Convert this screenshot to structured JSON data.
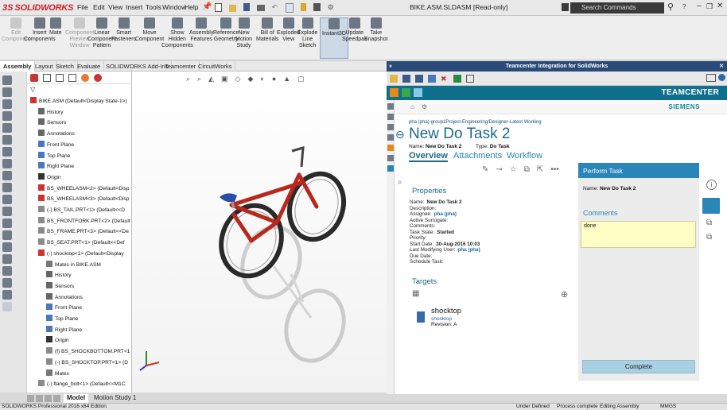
{
  "app": {
    "brand_ds": "3S",
    "brand_name": "SOLIDWORKS",
    "document_title": "BIKE.ASM.SLDASM [Read-only]",
    "search_placeholder": "Search Commands"
  },
  "menu": [
    "File",
    "Edit",
    "View",
    "Insert",
    "Tools",
    "Window",
    "Help"
  ],
  "commands": [
    {
      "label": "Edit\nComponent",
      "disabled": true,
      "icon": "edit-component-icon"
    },
    {
      "label": "Insert\nComponents",
      "disabled": false,
      "icon": "insert-components-icon"
    },
    {
      "label": "Mate",
      "disabled": false,
      "icon": "mate-icon"
    },
    {
      "label": "Component\nPreview\nWindow",
      "disabled": true,
      "icon": "component-preview-icon"
    },
    {
      "label": "Linear\nComponent\nPattern",
      "disabled": false,
      "icon": "linear-pattern-icon"
    },
    {
      "label": "Smart\nFasteners",
      "disabled": false,
      "icon": "smart-fasteners-icon"
    },
    {
      "label": "Move\nComponent",
      "disabled": false,
      "icon": "move-component-icon"
    },
    {
      "label": "Show\nHidden\nComponents",
      "disabled": false,
      "icon": "show-hidden-icon"
    },
    {
      "label": "Assembly\nFeatures",
      "disabled": false,
      "icon": "assembly-features-icon"
    },
    {
      "label": "Reference\nGeometry",
      "disabled": false,
      "icon": "reference-geometry-icon"
    },
    {
      "label": "New\nMotion\nStudy",
      "disabled": false,
      "icon": "motion-study-icon"
    },
    {
      "label": "Bill of\nMaterials",
      "disabled": false,
      "icon": "bill-of-materials-icon"
    },
    {
      "label": "Exploded\nView",
      "disabled": false,
      "icon": "exploded-view-icon"
    },
    {
      "label": "Explode\nLine\nSketch",
      "disabled": false,
      "icon": "explode-line-icon"
    },
    {
      "label": "Instant3D",
      "disabled": false,
      "icon": "instant3d-icon",
      "active": true
    },
    {
      "label": "Update\nSpeedpak",
      "disabled": false,
      "icon": "speedpak-icon"
    },
    {
      "label": "Take\nSnapshot",
      "disabled": false,
      "icon": "snapshot-icon"
    }
  ],
  "tabs": [
    "Assembly",
    "Layout",
    "Sketch",
    "Evaluate",
    "SOLIDWORKS Add-Ins",
    "Teamcenter",
    "CircuitWorks"
  ],
  "tree": [
    {
      "label": "BIKE.ASM  (Default<Display State-1>)",
      "indent": 0,
      "icon": "assembly-icon"
    },
    {
      "label": "History",
      "indent": 1,
      "icon": "history-icon"
    },
    {
      "label": "Sensors",
      "indent": 1,
      "icon": "sensors-icon"
    },
    {
      "label": "Annotations",
      "indent": 1,
      "icon": "annotations-icon"
    },
    {
      "label": "Front Plane",
      "indent": 1,
      "icon": "plane-icon"
    },
    {
      "label": "Top Plane",
      "indent": 1,
      "icon": "plane-icon"
    },
    {
      "label": "Right Plane",
      "indent": 1,
      "icon": "plane-icon"
    },
    {
      "label": "Origin",
      "indent": 1,
      "icon": "origin-icon"
    },
    {
      "label": "BS_WHEELASM<2> (Default<Disp",
      "indent": 1,
      "icon": "subassembly-icon"
    },
    {
      "label": "BS_WHEELASM<3> (Default<Disp",
      "indent": 1,
      "icon": "subassembly-icon"
    },
    {
      "label": "(-) BS_TAIL.PRT<1> (Default<<D",
      "indent": 1,
      "icon": "part-icon"
    },
    {
      "label": "BS_FRONTFORK.PRT<2> (Default",
      "indent": 1,
      "icon": "part-icon"
    },
    {
      "label": "BS_FRAME.PRT<3> (Default<<De",
      "indent": 1,
      "icon": "part-icon"
    },
    {
      "label": "BS_SEAT.PRT<1> (Default<<Def",
      "indent": 1,
      "icon": "part-icon"
    },
    {
      "label": "(-) shocktop<1> (Default<Display",
      "indent": 1,
      "icon": "subassembly-icon"
    },
    {
      "label": "Mates in BIKE.ASM",
      "indent": 2,
      "icon": "mates-icon"
    },
    {
      "label": "History",
      "indent": 2,
      "icon": "history-icon"
    },
    {
      "label": "Sensors",
      "indent": 2,
      "icon": "sensors-icon"
    },
    {
      "label": "Annotations",
      "indent": 2,
      "icon": "annotations-icon"
    },
    {
      "label": "Front Plane",
      "indent": 2,
      "icon": "plane-icon"
    },
    {
      "label": "Top Plane",
      "indent": 2,
      "icon": "plane-icon"
    },
    {
      "label": "Right Plane",
      "indent": 2,
      "icon": "plane-icon"
    },
    {
      "label": "Origin",
      "indent": 2,
      "icon": "origin-icon"
    },
    {
      "label": "(f) BS_SHOCKBOTTOM.PRT<1",
      "indent": 2,
      "icon": "part-icon"
    },
    {
      "label": "(-) BS_SHOCKTOP.PRT<1> (D",
      "indent": 2,
      "icon": "part-icon"
    },
    {
      "label": "Mates",
      "indent": 2,
      "icon": "mates-icon"
    },
    {
      "label": "(-) flange_bolt<1> (Default<<M1C",
      "indent": 1,
      "icon": "part-icon"
    }
  ],
  "bottom_tabs": [
    "Model",
    "Motion Study 1"
  ],
  "status": {
    "left": "SOLIDWORKS Professional 2016 x64 Edition",
    "items": [
      "Under Defined",
      "Process complete",
      "Editing Assembly",
      "MMGS"
    ]
  },
  "teamcenter": {
    "panel_title": "Teamcenter Integration for SolidWorks",
    "brand": "TEAMCENTER",
    "siemens": "SIEMENS",
    "breadcrumb": "pha (pha)-group1Project-Engineering/Designer-Latest Working",
    "task_title": "New Do Task 2",
    "name_label": "Name:",
    "name_value": "New Do Task 2",
    "type_label": "Type:",
    "type_value": "Do Task",
    "tabs": [
      "Overview",
      "Attachments",
      "Workflow"
    ],
    "properties_title": "Properties",
    "properties": [
      {
        "k": "Name:",
        "v": "New Do Task 2"
      },
      {
        "k": "Description:",
        "v": ""
      },
      {
        "k": "Assignee:",
        "v": "pha (pha)",
        "link": true
      },
      {
        "k": "Active Surrogate:",
        "v": ""
      },
      {
        "k": "Comments:",
        "v": ""
      },
      {
        "k": "Task State:",
        "v": "Started"
      },
      {
        "k": "Priority:",
        "v": ""
      },
      {
        "k": "Start Date:",
        "v": "30-Aug-2016 10:03"
      },
      {
        "k": "Last Modifying User:",
        "v": "pha (pha)",
        "link": true
      },
      {
        "k": "Due Date:",
        "v": ""
      },
      {
        "k": "Schedule Task:",
        "v": ""
      }
    ],
    "targets_title": "Targets",
    "target": {
      "name": "shocktop",
      "sub": "shocktop",
      "revision": "Revision: A"
    },
    "perform": {
      "title": "Perform Task",
      "name_label": "Name:",
      "name_value": "New Do Task 2",
      "comments_label": "Comments",
      "comment_value": "done",
      "complete_label": "Complete"
    }
  },
  "colors": {
    "brand_red": "#d21f26",
    "tc_blue": "#0f6f8c",
    "perform_blue": "#2a86b8",
    "frame_red": "#c0392b"
  }
}
